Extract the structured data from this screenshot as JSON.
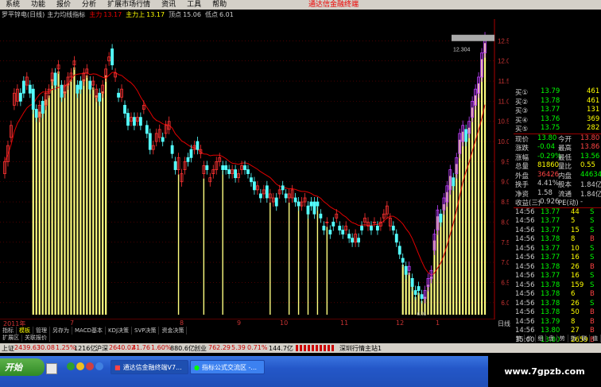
{
  "menu": {
    "items": [
      "系统",
      "功能",
      "报价",
      "分析",
      "扩展市场行情",
      "资讯",
      "工具",
      "帮助"
    ],
    "brand": "通达信金融终端"
  },
  "titlebar": {
    "stock": "罗平锌电(日线)",
    "indicator": "主力均线指标",
    "label1": "主力",
    "v1": "13.17",
    "label2": "主力上",
    "v2": "13.17",
    "label3": "顶点",
    "v3": "15.06",
    "label4": "低点",
    "v4": "6.01"
  },
  "chart_data": {
    "type": "candlestick",
    "ylim": [
      5.7,
      13.0
    ],
    "y_ticks": [
      "12.50",
      "12.00",
      "11.50",
      "11.00",
      "10.50",
      "10.00",
      "9.50",
      "9.00",
      "8.50",
      "8.00",
      "7.50",
      "7.00",
      "6.50",
      "6.00"
    ],
    "y_tick_values": [
      12.5,
      12.0,
      11.5,
      11.0,
      10.5,
      10.0,
      9.5,
      9.0,
      8.5,
      8.0,
      7.5,
      7.0,
      6.5,
      6.0
    ],
    "x_labels": [
      "2011年",
      "7",
      "8",
      "9",
      "10",
      "11",
      "12",
      "1",
      "2"
    ],
    "crosshair_price": "12.304",
    "low_marker": "6.01",
    "candles": [
      [
        9.2,
        9.5
      ],
      [
        9.5,
        9.9
      ],
      [
        10.1,
        10.4
      ],
      [
        10.9,
        11.2
      ],
      [
        11.0,
        11.3
      ],
      [
        11.2,
        11.0
      ],
      [
        11.5,
        11.2
      ],
      [
        11.4,
        11.6
      ],
      [
        11.4,
        11.2
      ],
      [
        11.3,
        10.8
      ],
      [
        10.8,
        10.6
      ],
      [
        10.6,
        10.9
      ],
      [
        11.0,
        10.7
      ],
      [
        10.9,
        11.2
      ],
      [
        11.2,
        11.3
      ],
      [
        11.5,
        11.7
      ],
      [
        11.7,
        11.4
      ],
      [
        11.8,
        11.9
      ],
      [
        11.4,
        11.1
      ],
      [
        11.2,
        11.4
      ],
      [
        11.4,
        11.6
      ],
      [
        11.6,
        11.7
      ],
      [
        11.9,
        12.0
      ],
      [
        11.4,
        11.2
      ],
      [
        11.5,
        11.3
      ],
      [
        11.5,
        11.7
      ],
      [
        11.7,
        11.8
      ],
      [
        11.5,
        11.3
      ],
      [
        11.4,
        11.5
      ],
      [
        11.1,
        11.3
      ],
      [
        11.2,
        11.0
      ],
      [
        11.2,
        11.4
      ],
      [
        11.6,
        11.8
      ],
      [
        12.0,
        12.1
      ],
      [
        12.3,
        11.9
      ],
      [
        11.6,
        11.7
      ],
      [
        11.2,
        11.1
      ],
      [
        11.1,
        11.3
      ],
      [
        10.9,
        10.7
      ],
      [
        10.7,
        10.4
      ],
      [
        10.5,
        10.6
      ],
      [
        10.6,
        10.4
      ],
      [
        10.5,
        10.6
      ],
      [
        10.6,
        10.4
      ],
      [
        10.8,
        10.9
      ],
      [
        10.4,
        10.2
      ],
      [
        10.2,
        9.8
      ],
      [
        9.8,
        9.9
      ],
      [
        10.0,
        10.2
      ],
      [
        10.1,
        10.3
      ],
      [
        10.1,
        10.0
      ],
      [
        10.2,
        10.4
      ],
      [
        10.3,
        10.5
      ],
      [
        9.9,
        9.7
      ],
      [
        9.5,
        9.3
      ],
      [
        9.3,
        9.6
      ],
      [
        9.0,
        9.2
      ],
      [
        9.3,
        9.5
      ],
      [
        9.6,
        9.5
      ],
      [
        9.8,
        9.6
      ],
      [
        9.8,
        9.9
      ],
      [
        10.0,
        9.8
      ],
      [
        9.7,
        9.8
      ],
      [
        9.2,
        9.4
      ],
      [
        9.4,
        9.3
      ],
      [
        9.0,
        9.1
      ],
      [
        9.2,
        9.3
      ],
      [
        9.3,
        9.5
      ],
      [
        9.5,
        9.6
      ],
      [
        9.4,
        9.3
      ],
      [
        9.4,
        9.3
      ],
      [
        9.3,
        9.2
      ],
      [
        9.2,
        9.3
      ],
      [
        9.3,
        9.1
      ],
      [
        9.1,
        9.2
      ],
      [
        9.3,
        9.4
      ],
      [
        9.4,
        9.3
      ],
      [
        9.3,
        9.2
      ],
      [
        9.1,
        9.0
      ],
      [
        9.0,
        8.8
      ],
      [
        8.8,
        8.9
      ],
      [
        8.7,
        8.6
      ],
      [
        8.7,
        8.8
      ],
      [
        8.9,
        8.6
      ],
      [
        8.6,
        8.7
      ],
      [
        8.5,
        8.6
      ],
      [
        8.6,
        8.4
      ],
      [
        8.7,
        8.8
      ],
      [
        8.9,
        8.8
      ],
      [
        8.7,
        8.6
      ],
      [
        8.6,
        8.7
      ],
      [
        8.6,
        8.8
      ],
      [
        8.6,
        8.5
      ],
      [
        8.5,
        8.4
      ],
      [
        8.4,
        8.5
      ],
      [
        8.5,
        8.6
      ],
      [
        8.4,
        8.2
      ],
      [
        8.5,
        8.4
      ],
      [
        8.5,
        8.2
      ],
      [
        8.5,
        8.4
      ],
      [
        8.2,
        8.1
      ],
      [
        7.9,
        7.8
      ],
      [
        8.0,
        8.0
      ],
      [
        7.8,
        7.7
      ],
      [
        8.0,
        7.9
      ],
      [
        8.1,
        8.2
      ],
      [
        7.9,
        7.8
      ],
      [
        7.8,
        7.7
      ],
      [
        7.8,
        7.9
      ],
      [
        7.7,
        7.6
      ],
      [
        7.6,
        7.5
      ],
      [
        7.5,
        7.7
      ],
      [
        7.6,
        7.5
      ],
      [
        7.9,
        7.8
      ],
      [
        8.0,
        8.1
      ],
      [
        7.9,
        8.0
      ],
      [
        7.9,
        7.8
      ],
      [
        8.0,
        8.0
      ],
      [
        7.9,
        7.8
      ],
      [
        7.9,
        8.0
      ],
      [
        8.1,
        8.2
      ],
      [
        8.2,
        8.4
      ],
      [
        7.9,
        8.1
      ],
      [
        7.9,
        7.8
      ],
      [
        7.7,
        7.5
      ],
      [
        7.4,
        7.2
      ],
      [
        7.1,
        7.0
      ],
      [
        6.9,
        6.7
      ],
      [
        6.8,
        6.9
      ],
      [
        6.6,
        6.4
      ],
      [
        6.3,
        6.2
      ],
      [
        6.4,
        6.3
      ],
      [
        6.2,
        6.1
      ],
      [
        6.1,
        6.3
      ],
      [
        6.4,
        6.6
      ],
      [
        6.6,
        6.8
      ],
      [
        7.3,
        7.7
      ],
      [
        7.8,
        8.3
      ],
      [
        8.2,
        8.0
      ],
      [
        8.3,
        8.6
      ],
      [
        8.5,
        8.9
      ],
      [
        8.8,
        9.3
      ],
      [
        9.1,
        8.9
      ],
      [
        9.2,
        9.6
      ],
      [
        9.7,
        10.2
      ],
      [
        10.0,
        10.4
      ],
      [
        10.3,
        10.0
      ],
      [
        10.2,
        10.5
      ],
      [
        10.6,
        11.0
      ],
      [
        10.9,
        11.3
      ],
      [
        11.2,
        11.6
      ],
      [
        11.6,
        12.2
      ],
      [
        12.2,
        12.6
      ]
    ]
  },
  "date_labels": [
    "2011年",
    "7",
    "8",
    "9",
    "10",
    "11",
    "12",
    "1",
    "2"
  ],
  "right_label": "日线",
  "index_tabs": [
    "指标",
    "模板",
    "管理",
    "另存为",
    "MACD基本",
    "KDJ决策",
    "SVP决策",
    "资金决策"
  ],
  "ext_tabs": [
    "扩展区",
    "关联报价"
  ],
  "quote": {
    "asks": [
      {
        "l": "买①",
        "p": "13.79",
        "v": "461"
      },
      {
        "l": "买②",
        "p": "13.78",
        "v": "461"
      },
      {
        "l": "买③",
        "p": "13.77",
        "v": "131"
      },
      {
        "l": "买④",
        "p": "13.76",
        "v": "369"
      },
      {
        "l": "买⑤",
        "p": "13.75",
        "v": "282"
      }
    ],
    "info": [
      {
        "a": "现价",
        "b": "13.80",
        "c": "今开",
        "d": "13.80"
      },
      {
        "a": "涨跌",
        "b": "-0.04",
        "c": "最高",
        "d": "13.86"
      },
      {
        "a": "涨幅",
        "b": "-0.29%",
        "c": "最低",
        "d": "13.56"
      },
      {
        "a": "总量",
        "b": "81860",
        "c": "量比",
        "d": "0.55"
      },
      {
        "a": "外盘",
        "b": "36426",
        "c": "内盘",
        "d": "44634"
      },
      {
        "a": "换手",
        "b": "4.41%",
        "c": "股本",
        "d": "1.84亿"
      },
      {
        "a": "净资",
        "b": "1.58",
        "c": "流通",
        "d": "1.84亿"
      },
      {
        "a": "收益(三)",
        "b": "-0.926",
        "c": "PE(动)",
        "d": "-"
      }
    ],
    "ticks": [
      {
        "t": "14:56",
        "p": "13.77",
        "v": "44",
        "d": "S"
      },
      {
        "t": "14:56",
        "p": "13.77",
        "v": "5",
        "d": "S"
      },
      {
        "t": "14:56",
        "p": "13.77",
        "v": "15",
        "d": "S"
      },
      {
        "t": "14:56",
        "p": "13.78",
        "v": "8",
        "d": "B"
      },
      {
        "t": "14:56",
        "p": "13.77",
        "v": "10",
        "d": "S"
      },
      {
        "t": "14:56",
        "p": "13.77",
        "v": "16",
        "d": "S"
      },
      {
        "t": "14:56",
        "p": "13.78",
        "v": "26",
        "d": "B"
      },
      {
        "t": "14:56",
        "p": "13.77",
        "v": "16",
        "d": "S"
      },
      {
        "t": "14:56",
        "p": "13.78",
        "v": "159",
        "d": "S"
      },
      {
        "t": "14:56",
        "p": "13.78",
        "v": "6",
        "d": "B"
      },
      {
        "t": "14:56",
        "p": "13.78",
        "v": "26",
        "d": "S"
      },
      {
        "t": "14:56",
        "p": "13.78",
        "v": "50",
        "d": "B"
      },
      {
        "t": "14:56",
        "p": "13.79",
        "v": "8",
        "d": "B"
      },
      {
        "t": "14:56",
        "p": "13.80",
        "v": "27",
        "d": "B"
      },
      {
        "t": "15:00",
        "p": "13.80",
        "v": "2659",
        "d": "B"
      }
    ]
  },
  "right_tabs": [
    "笔",
    "价",
    "细",
    "盘",
    "势",
    "指",
    "联",
    "值"
  ],
  "status": {
    "sh_label": "上证",
    "sh_val": "2439.63",
    "sh_chg": "30.08",
    "sh_pct": "1.25%",
    "sh_amt": "1216亿",
    "sz_label": "沪深",
    "sz_val": "2640.02",
    "sz_chg": "41.76",
    "sz_pct": "1.60%",
    "sz_amt": "880.6亿",
    "cy_label": "创业",
    "cy_val": "762.29",
    "cy_chg": "5.39",
    "cy_pct": "0.71%",
    "cy_amt": "144.7亿",
    "site": "深圳行情主站1"
  },
  "taskbar": {
    "start": "开始",
    "task1": "通达信金融终端V7...",
    "task2": "指标公式交流区 -..."
  },
  "watermark": "www.7gpzb.com",
  "colors": {
    "up": "#ff3232",
    "down": "#54ffff",
    "volume": "#ffff80",
    "ma": "#e00000",
    "accent": "#c040ff"
  }
}
